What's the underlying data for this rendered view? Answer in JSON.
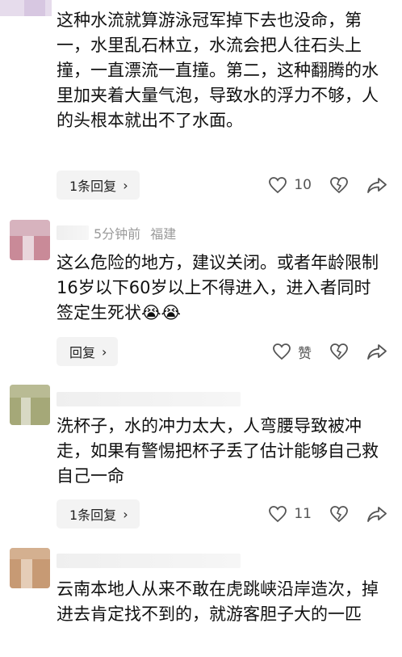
{
  "comments": [
    {
      "text": "这种水流就算游泳冠军掉下去也没命，第一，水里乱石林立，水流会把人往石头上撞，一直漂流一直撞。第二，这种翻腾的水里加夹着大量气泡，导致水的浮力不够，人的头根本就出不了水面。",
      "reply_label": "1条回复",
      "like_count": "10"
    },
    {
      "time": "5分钟前",
      "location": "福建",
      "text": "这么危险的地方，建议关闭。或者年龄限制16岁以下60岁以上不得进入，进入者同时签定生死状",
      "emojis": [
        "😭",
        "😭"
      ],
      "reply_label": "回复",
      "like_label": "赞"
    },
    {
      "text": "洗杯子，水的冲力太大，人弯腰导致被冲走，如果有警惕把杯子丢了估计能够自己救自己一命",
      "reply_label": "1条回复",
      "like_count": "11"
    },
    {
      "text": "云南本地人从来不敢在虎跳峡沿岸造次，掉进去肯定找不到的，就游客胆子大的一匹"
    }
  ],
  "icons": {
    "like": "heart-outline-icon",
    "dislike": "broken-heart-icon",
    "share": "share-arrow-icon",
    "chevron": "chevron-right-icon"
  },
  "colors": {
    "avatar_pink": "#c98a98",
    "avatar_green": "#a5a878",
    "avatar_tan": "#c79a74",
    "button_bg": "#f3f3f3"
  }
}
